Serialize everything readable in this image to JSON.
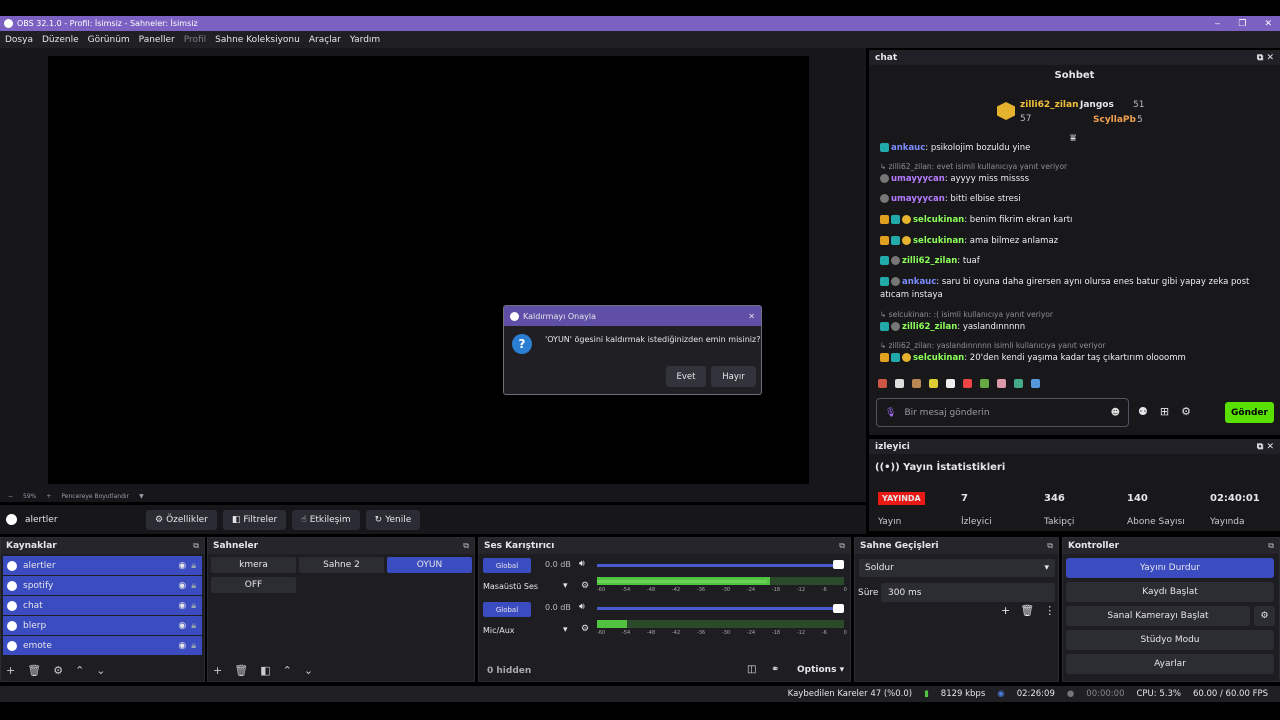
{
  "window": {
    "title": "OBS 32.1.0 - Profil: İsimsiz - Sahneler: İsimsiz",
    "minimize": "‒",
    "restore": "❐",
    "close": "✕"
  },
  "menu": [
    "Dosya",
    "Düzenle",
    "Görünüm",
    "Paneller",
    "Profil",
    "Sahne Koleksiyonu",
    "Araçlar",
    "Yardım"
  ],
  "zoom": {
    "minus": "−",
    "value": "59%",
    "plus": "+",
    "fit": "Pencereye Boyutlandır"
  },
  "source_toolbar": {
    "selected": "alertler",
    "buttons": [
      "Özellikler",
      "Filtreler",
      "Etkileşim",
      "Yenile"
    ]
  },
  "sources": {
    "title": "Kaynaklar",
    "items": [
      "alertler",
      "spotify",
      "chat",
      "blerp",
      "emote"
    ]
  },
  "scenes": {
    "title": "Sahneler",
    "items": [
      "kmera",
      "Sahne 2",
      "OYUN",
      "OFF"
    ],
    "active": "OYUN"
  },
  "mixer": {
    "title": "Ses Karıştırıcı",
    "channels": [
      {
        "tag": "Global",
        "db": "0.0 dB",
        "name": "Masaüstü Ses"
      },
      {
        "tag": "Global",
        "db": "0.0 dB",
        "name": "Mic/Aux"
      }
    ],
    "ticks": [
      "-60",
      "-54",
      "-48",
      "-42",
      "-36",
      "-30",
      "-24",
      "-18",
      "-12",
      "-6",
      "0"
    ],
    "hidden": "0 hidden",
    "options": "Options"
  },
  "transitions": {
    "title": "Sahne Geçişleri",
    "type": "Soldur",
    "duration_label": "Süre",
    "duration": "300 ms"
  },
  "controls": {
    "title": "Kontroller",
    "buttons": [
      "Yayını Durdur",
      "Kaydı Başlat",
      "Sanal Kamerayı Başlat",
      "Stüdyo Modu",
      "Ayarlar"
    ]
  },
  "status": {
    "dropped": "Kaybedilen Kareler 47 (%0.0)",
    "bitrate": "8129 kbps",
    "stream_time": "02:26:09",
    "rec_time": "00:00:00",
    "cpu": "CPU: 5.3%",
    "fps": "60.00 / 60.00 FPS"
  },
  "dialog": {
    "title": "Kaldırmayı Onayla",
    "message": "'OYUN' ögesini kaldırmak istediğinizden emin misiniz?",
    "yes": "Evet",
    "no": "Hayır"
  },
  "chat": {
    "dock_title": "chat",
    "header": "Sohbet",
    "leaders": [
      {
        "name": "zilli62_zilan",
        "score": "57"
      },
      {
        "name": "Jangos",
        "score": "51"
      },
      {
        "name": "ScyllaPb",
        "score": "5"
      }
    ],
    "messages": [
      {
        "reply": "",
        "user": "ankauc",
        "text": ": psikolojim bozuldu yine",
        "color": "#7c8cff"
      },
      {
        "reply": "↳ zilli62_zilan: evet isimli kullanıcıya yanıt veriyor",
        "user": "umayyycan",
        "text": ": ayyyy miss missss",
        "color": "#b57bff"
      },
      {
        "reply": "",
        "user": "umayyycan",
        "text": ": bitti elbise stresi",
        "color": "#b57bff"
      },
      {
        "reply": "",
        "user": "selcukinan",
        "text": ": benim fikrim ekran kartı",
        "color": "#8cff5a"
      },
      {
        "reply": "",
        "user": "selcukinan",
        "text": ": ama bilmez anlamaz",
        "color": "#8cff5a"
      },
      {
        "reply": "",
        "user": "zilli62_zilan",
        "text": ": tuaf",
        "color": "#8cff5a"
      },
      {
        "reply": "",
        "user": "ankauc",
        "text": ": saru bi oyuna daha girersen aynı olursa enes batur gibi yapay zeka post atıcam instaya",
        "color": "#7c8cff"
      },
      {
        "reply": "↳ selcukinan: :( isimli kullanıcıya yanıt veriyor",
        "user": "zilli62_zilan",
        "text": ": yaslandınnnnn",
        "color": "#8cff5a"
      },
      {
        "reply": "↳ zilli62_zilan: yaslandınnnnn isimli kullanıcıya yanıt veriyor",
        "user": "selcukinan",
        "text": ": 20'den kendi yaşıma kadar taş çıkartırım olooomm",
        "color": "#8cff5a"
      }
    ],
    "placeholder": "Bir mesaj gönderin",
    "send": "Gönder"
  },
  "stats": {
    "dock_title": "izleyici",
    "header": "Yayın İstatistikleri",
    "live": "YAYINDA",
    "live_label": "Yayın",
    "items": [
      {
        "value": "7",
        "label": "İzleyici"
      },
      {
        "value": "346",
        "label": "Takipçi"
      },
      {
        "value": "140",
        "label": "Abone Sayısı"
      },
      {
        "value": "02:40:01",
        "label": "Yayında"
      }
    ]
  }
}
